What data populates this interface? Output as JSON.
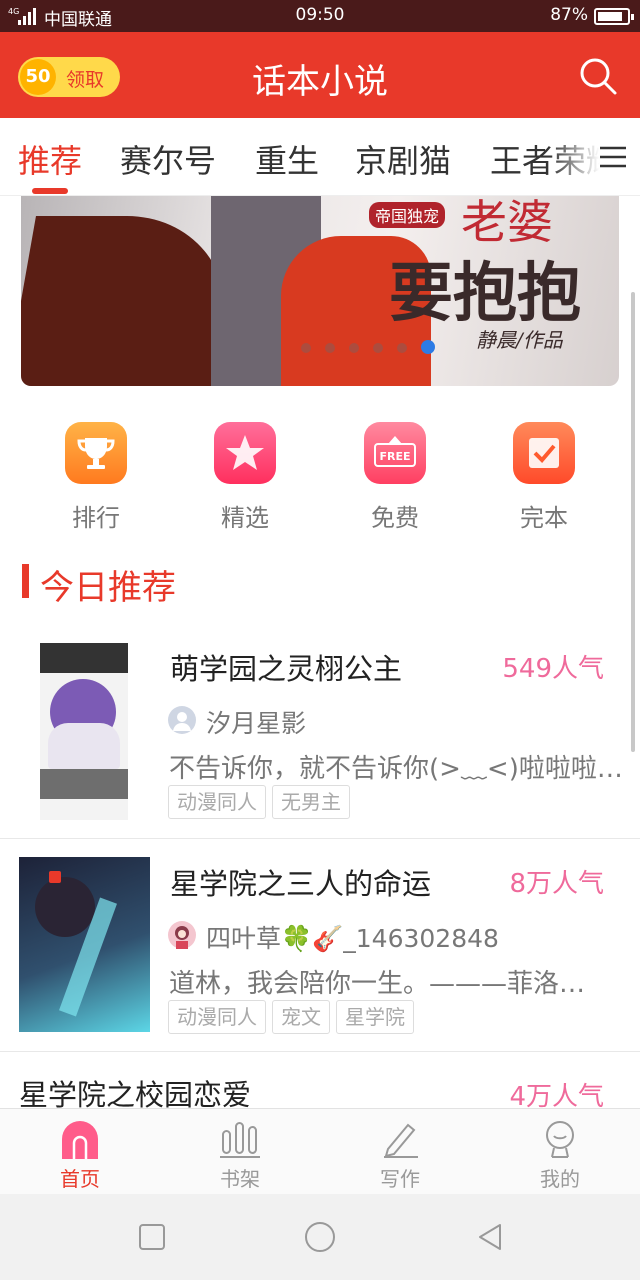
{
  "status_bar": {
    "network": "4G",
    "carrier": "中国联通",
    "time": "09:50",
    "battery": "87%",
    "battery_level": 0.87
  },
  "header": {
    "coin_amount": "50",
    "claim_label": "领取",
    "title": "话本小说",
    "search_icon": "search-icon"
  },
  "tabs": [
    {
      "label": "推荐",
      "active": true
    },
    {
      "label": "赛尔号",
      "active": false
    },
    {
      "label": "重生",
      "active": false
    },
    {
      "label": "京剧猫",
      "active": false
    },
    {
      "label": "王者荣耀",
      "active": false
    }
  ],
  "banner": {
    "tag": "帝国独宠",
    "title_line1": "老婆",
    "title_line2": "要抱抱",
    "author": "静晨/作品",
    "dot_count": 6,
    "active_dot": 5
  },
  "quick_nav": [
    {
      "label": "排行",
      "icon": "trophy-icon",
      "color": "#ff8a1f"
    },
    {
      "label": "精选",
      "icon": "star-icon",
      "color": "#ff3f6c"
    },
    {
      "label": "免费",
      "icon": "free-icon",
      "color": "#ff4f6a"
    },
    {
      "label": "完本",
      "icon": "checkbox-icon",
      "color": "#ff5a2e"
    }
  ],
  "section": {
    "title": "今日推荐"
  },
  "books": [
    {
      "title": "萌学园之灵栩公主",
      "popularity": "549人气",
      "author": "汐月星影",
      "description": "不告诉你，就不告诉你(>﹏<)啦啦啦…",
      "tags": [
        "动漫同人",
        "无男主"
      ]
    },
    {
      "title": "星学院之三人的命运",
      "popularity": "8万人气",
      "author": "四叶草🍀🎸_146302848",
      "description": "道林，我会陪你一生。———菲洛…",
      "tags": [
        "动漫同人",
        "宠文",
        "星学院"
      ]
    },
    {
      "title": "星学院之校园恋爱",
      "popularity": "4万人气"
    }
  ],
  "bottom_nav": [
    {
      "label": "首页",
      "icon": "home-icon",
      "active": true
    },
    {
      "label": "书架",
      "icon": "bookshelf-icon",
      "active": false
    },
    {
      "label": "写作",
      "icon": "pencil-icon",
      "active": false
    },
    {
      "label": "我的",
      "icon": "profile-icon",
      "active": false
    }
  ],
  "colors": {
    "brand": "#e8392a",
    "popularity": "#ef6a9b",
    "coin": "#ffd94a"
  }
}
